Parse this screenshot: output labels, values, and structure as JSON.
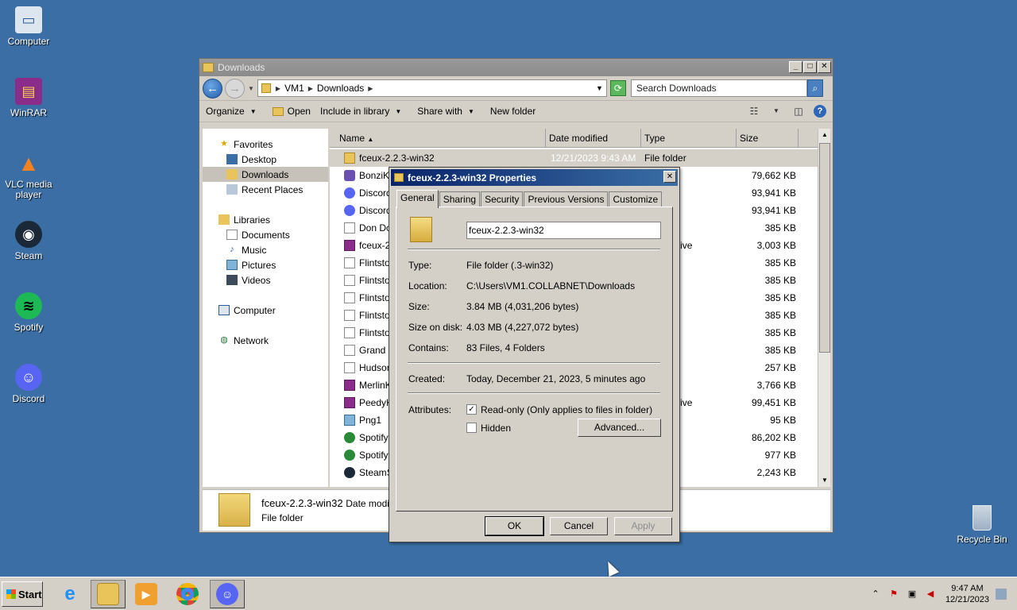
{
  "desktop": {
    "icons": [
      {
        "label": "Computer",
        "icon": "computer-icon"
      },
      {
        "label": "WinRAR",
        "icon": "winrar-icon"
      },
      {
        "label": "VLC media player",
        "icon": "vlc-icon"
      },
      {
        "label": "Steam",
        "icon": "steam-icon"
      },
      {
        "label": "Spotify",
        "icon": "spotify-icon"
      },
      {
        "label": "Discord",
        "icon": "discord-icon"
      }
    ],
    "recycle_bin": "Recycle Bin"
  },
  "explorer": {
    "title": "Downloads",
    "address": {
      "root": "VM1",
      "folder": "Downloads"
    },
    "search_placeholder": "Search Downloads",
    "toolbar": {
      "organize": "Organize",
      "open": "Open",
      "include_in_library": "Include in library",
      "share_with": "Share with",
      "new_folder": "New folder"
    },
    "nav": {
      "favorites": "Favorites",
      "desktop": "Desktop",
      "downloads": "Downloads",
      "recent_places": "Recent Places",
      "libraries": "Libraries",
      "documents": "Documents",
      "music": "Music",
      "pictures": "Pictures",
      "videos": "Videos",
      "computer": "Computer",
      "network": "Network"
    },
    "columns": {
      "name": "Name",
      "date": "Date modified",
      "type": "Type",
      "size": "Size"
    },
    "files": [
      {
        "name": "fceux-2.2.3-win32",
        "date": "12/21/2023 9:43 AM",
        "type": "File folder",
        "size": "",
        "icon": "folder"
      },
      {
        "name": "BonziKill",
        "date": "",
        "type": "n",
        "size": "79,662 KB",
        "icon": "app"
      },
      {
        "name": "DiscordS",
        "date": "",
        "type": "n",
        "size": "93,941 KB",
        "icon": "disc"
      },
      {
        "name": "DiscordS",
        "date": "",
        "type": "n",
        "size": "93,941 KB",
        "icon": "disc"
      },
      {
        "name": "Don Dok",
        "date": "",
        "type": "",
        "size": "385 KB",
        "icon": "doc"
      },
      {
        "name": "fceux-2",
        "date": "",
        "type": "ZIP archive",
        "size": "3,003 KB",
        "icon": "rar"
      },
      {
        "name": "Flintstor",
        "date": "",
        "type": "",
        "size": "385 KB",
        "icon": "doc"
      },
      {
        "name": "Flintstor",
        "date": "",
        "type": "",
        "size": "385 KB",
        "icon": "doc"
      },
      {
        "name": "Flintstor",
        "date": "",
        "type": "",
        "size": "385 KB",
        "icon": "doc"
      },
      {
        "name": "Flintstor",
        "date": "",
        "type": "",
        "size": "385 KB",
        "icon": "doc"
      },
      {
        "name": "Flintstor",
        "date": "",
        "type": "",
        "size": "385 KB",
        "icon": "doc"
      },
      {
        "name": "Grand D",
        "date": "",
        "type": "",
        "size": "385 KB",
        "icon": "doc"
      },
      {
        "name": "Hudson'",
        "date": "",
        "type": "",
        "size": "257 KB",
        "icon": "doc"
      },
      {
        "name": "MerlinKil",
        "date": "",
        "type": "archive",
        "size": "3,766 KB",
        "icon": "rar"
      },
      {
        "name": "PeedyKi",
        "date": "",
        "type": "ZIP archive",
        "size": "99,451 KB",
        "icon": "rar"
      },
      {
        "name": "Png1",
        "date": "",
        "type": "ge",
        "size": "95 KB",
        "icon": "img"
      },
      {
        "name": "SpotifyF",
        "date": "",
        "type": "n",
        "size": "86,202 KB",
        "icon": "green"
      },
      {
        "name": "SpotifyS",
        "date": "",
        "type": "n",
        "size": "977 KB",
        "icon": "green"
      },
      {
        "name": "SteamSe",
        "date": "",
        "type": "n",
        "size": "2,243 KB",
        "icon": "steam"
      }
    ],
    "details": {
      "name": "fceux-2.2.3-win32",
      "date_label": "Date modifi",
      "type": "File folder"
    }
  },
  "properties": {
    "title": "fceux-2.2.3-win32 Properties",
    "tabs": [
      "General",
      "Sharing",
      "Security",
      "Previous Versions",
      "Customize"
    ],
    "name_value": "fceux-2.2.3-win32",
    "labels": {
      "type": "Type:",
      "location": "Location:",
      "size": "Size:",
      "size_on_disk": "Size on disk:",
      "contains": "Contains:",
      "created": "Created:",
      "attributes": "Attributes:"
    },
    "values": {
      "type": "File folder (.3-win32)",
      "location": "C:\\Users\\VM1.COLLABNET\\Downloads",
      "size": "3.84 MB (4,031,206 bytes)",
      "size_on_disk": "4.03 MB (4,227,072 bytes)",
      "contains": "83 Files, 4 Folders",
      "created": "Today, December 21, 2023, 5 minutes ago"
    },
    "readonly_label": "Read-only (Only applies to files in folder)",
    "hidden_label": "Hidden",
    "advanced_label": "Advanced...",
    "ok_label": "OK",
    "cancel_label": "Cancel",
    "apply_label": "Apply"
  },
  "taskbar": {
    "start_label": "Start",
    "time": "9:47 AM",
    "date": "12/21/2023"
  }
}
